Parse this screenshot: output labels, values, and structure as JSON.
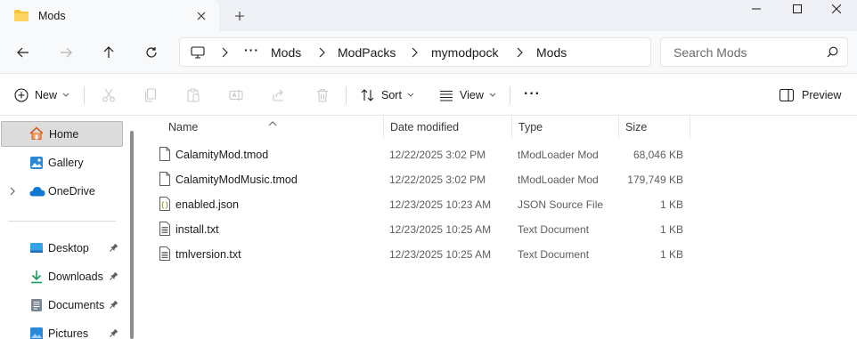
{
  "window": {
    "tab_title": "Mods",
    "tab_icon": "folder-icon",
    "new_tab_icon": "plus-icon",
    "controls": [
      "minimize-icon",
      "maximize-icon",
      "close-icon"
    ]
  },
  "address": {
    "crumbs": [
      "Mods",
      "ModPacks",
      "mymodpock",
      "Mods"
    ],
    "overflow_label": "···"
  },
  "search": {
    "placeholder": "Search Mods"
  },
  "commands": {
    "new_label": "New",
    "sort_label": "Sort",
    "view_label": "View",
    "more_label": "···",
    "preview_label": "Preview"
  },
  "sidebar": {
    "items": [
      {
        "label": "Home",
        "icon": "home-icon"
      },
      {
        "label": "Gallery",
        "icon": "gallery-icon"
      },
      {
        "label": "OneDrive",
        "icon": "cloud-icon"
      },
      {
        "label": "Desktop",
        "icon": "desktop-icon"
      },
      {
        "label": "Downloads",
        "icon": "download-icon"
      },
      {
        "label": "Documents",
        "icon": "documents-icon"
      },
      {
        "label": "Pictures",
        "icon": "pictures-icon"
      }
    ]
  },
  "columns": {
    "name": "Name",
    "date": "Date modified",
    "type": "Type",
    "size": "Size"
  },
  "files": [
    {
      "name": "CalamityMod.tmod",
      "date": "12/22/2025 3:02 PM",
      "type": "tModLoader Mod",
      "size": "68,046 KB",
      "icon": "file-icon"
    },
    {
      "name": "CalamityModMusic.tmod",
      "date": "12/22/2025 3:02 PM",
      "type": "tModLoader Mod",
      "size": "179,749 KB",
      "icon": "file-icon"
    },
    {
      "name": "enabled.json",
      "date": "12/23/2025 10:23 AM",
      "type": "JSON Source File",
      "size": "1 KB",
      "icon": "json-file-icon"
    },
    {
      "name": "install.txt",
      "date": "12/23/2025 10:25 AM",
      "type": "Text Document",
      "size": "1 KB",
      "icon": "text-file-icon"
    },
    {
      "name": "tmlversion.txt",
      "date": "12/23/2025 10:25 AM",
      "type": "Text Document",
      "size": "1 KB",
      "icon": "text-file-icon"
    }
  ],
  "colors": {
    "accent": "#0067c0",
    "folder": "#f8c53a",
    "selection": "#dcdcdc"
  }
}
